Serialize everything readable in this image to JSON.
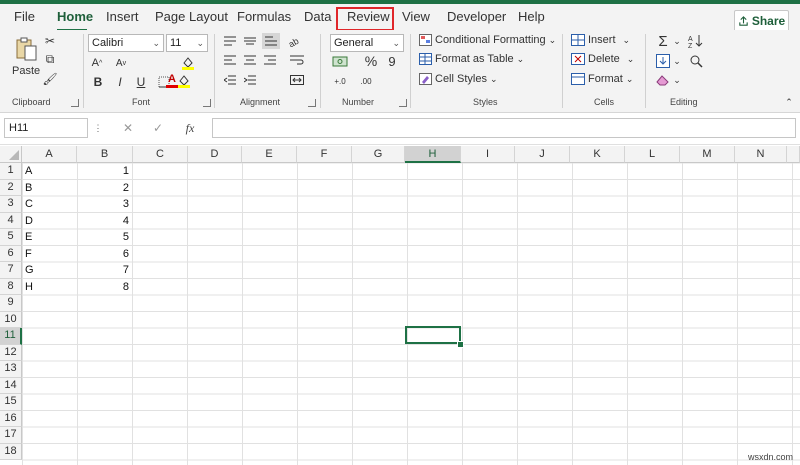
{
  "menu": {
    "tabs": [
      "File",
      "Home",
      "Insert",
      "Page Layout",
      "Formulas",
      "Data",
      "Review",
      "View",
      "Developer",
      "Help"
    ],
    "active": "Home",
    "highlighted": "Review",
    "share_label": "Share"
  },
  "ribbon": {
    "clipboard": {
      "paste_label": "Paste",
      "group_label": "Clipboard"
    },
    "font": {
      "font_name": "Calibri",
      "font_size": "11",
      "group_label": "Font",
      "bold": "B",
      "italic": "I",
      "underline": "U",
      "font_color_letter": "A"
    },
    "alignment": {
      "group_label": "Alignment"
    },
    "number": {
      "format": "General",
      "group_label": "Number",
      "percent": "%",
      "comma": "9"
    },
    "styles": {
      "conditional": "Conditional Formatting",
      "format_table": "Format as Table",
      "cell_styles": "Cell Styles",
      "group_label": "Styles"
    },
    "cells": {
      "insert": "Insert",
      "delete": "Delete",
      "format": "Format",
      "group_label": "Cells"
    },
    "editing": {
      "group_label": "Editing"
    }
  },
  "formula_bar": {
    "name_box": "H11",
    "fx": "fx",
    "content": ""
  },
  "grid": {
    "columns": [
      "A",
      "B",
      "C",
      "D",
      "E",
      "F",
      "G",
      "H",
      "I",
      "J",
      "K",
      "L",
      "M",
      "N"
    ],
    "selected_column": "H",
    "rows": [
      "1",
      "2",
      "3",
      "4",
      "5",
      "6",
      "7",
      "8",
      "9",
      "10",
      "11",
      "12",
      "13",
      "14",
      "15",
      "16",
      "17",
      "18"
    ],
    "selected_row": "11",
    "col_a": [
      "A",
      "B",
      "C",
      "D",
      "E",
      "F",
      "G",
      "H"
    ],
    "col_b": [
      "1",
      "2",
      "3",
      "4",
      "5",
      "6",
      "7",
      "8"
    ]
  },
  "watermark": "wsxdn.com",
  "colors": {
    "accent": "#1e7145",
    "highlight_box": "#e0262a"
  }
}
